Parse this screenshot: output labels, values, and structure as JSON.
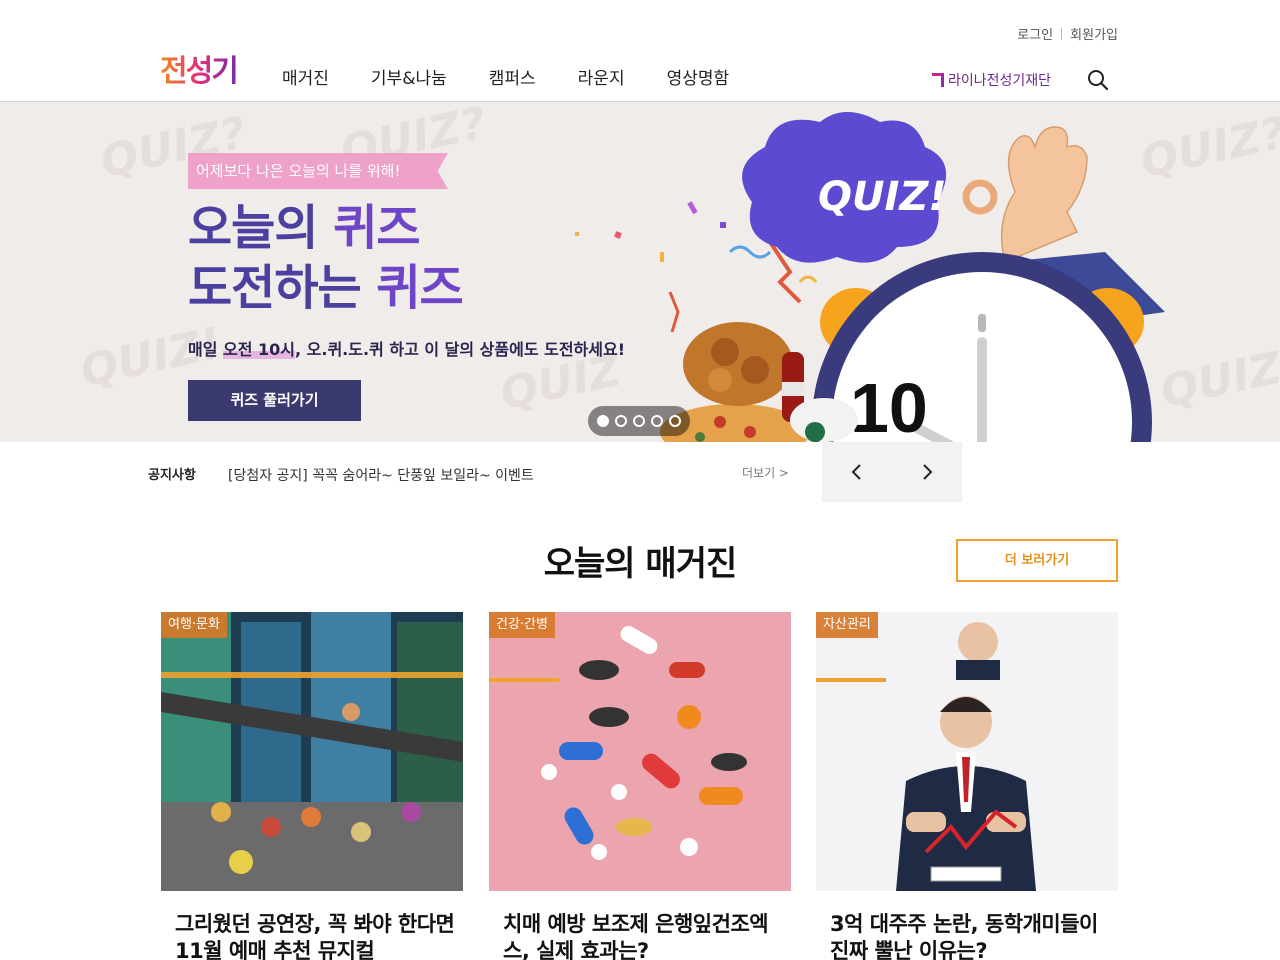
{
  "header": {
    "util": {
      "login": "로그인",
      "signup": "회원가입"
    },
    "logo_text": "전성기",
    "nav": [
      "매거진",
      "기부&나눔",
      "캠퍼스",
      "라운지",
      "영상명함"
    ],
    "foundation": "라이나전성기재단"
  },
  "hero": {
    "tag": "어제보다 나은 오늘의 나를 위해!",
    "title_line1_a": "오늘의 ",
    "title_line1_b": "퀴즈",
    "title_line2_a": "도전하는 ",
    "title_line2_b": "퀴즈",
    "subtitle_a": "매일 ",
    "subtitle_hl": "오전 10시",
    "subtitle_b": ", 오.퀴.도.퀴 하고 이 달의 상품에도 도전하세요!",
    "cta": "퀴즈 풀러가기",
    "bubble_text": "QUIZ!",
    "clock_number": "10",
    "slides_total": 5,
    "slide_active": 1
  },
  "notice": {
    "label": "공지사항",
    "text": "[당첨자 공지] 꼭꼭 숨어라~ 단풍잎 보일라~ 이벤트",
    "more": "더보기 >"
  },
  "magazine": {
    "title": "오늘의 매거진",
    "more": "더 보러가기",
    "cards": [
      {
        "category": "여행·문화",
        "title": "그리웠던 공연장, 꼭 봐야 한다면 11월 예매 추천 뮤지컬"
      },
      {
        "category": "건강·간병",
        "title": "치매 예방 보조제 은행잎건조엑스, 실제 효과는?"
      },
      {
        "category": "자산관리",
        "title": "3억 대주주 논란, 동학개미들이 진짜 뿔난 이유는?"
      }
    ]
  },
  "colors": {
    "brand_purple": "#4b3fa0",
    "accent_orange": "#f0a22e",
    "cta_navy": "#3b3a6e"
  }
}
